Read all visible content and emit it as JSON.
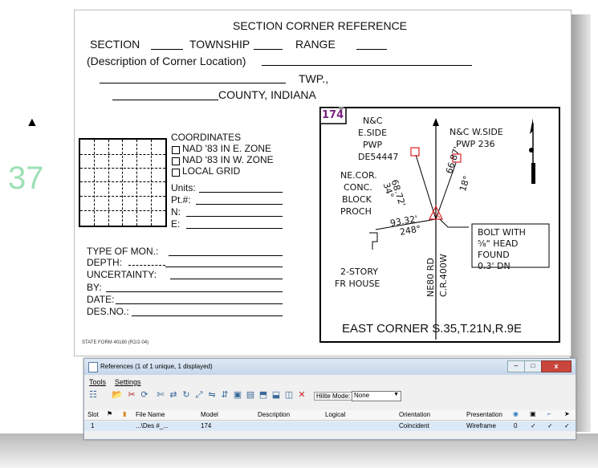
{
  "side": {
    "triangle": "▲",
    "number": "37"
  },
  "form": {
    "title": "SECTION CORNER REFERENCE",
    "section_label": "SECTION",
    "township_label": "TOWNSHIP",
    "range_label": "RANGE",
    "description_label": "(Description of Corner Location)",
    "twp_label": "TWP.,",
    "county_label": "COUNTY, INDIANA",
    "coordinates_label": "COORDINATES",
    "nad_e": "NAD '83 IN E. ZONE",
    "nad_w": "NAD '83 IN W. ZONE",
    "local_grid": "LOCAL GRID",
    "units": "Units:",
    "pt": "Pt.#:",
    "n": "N:",
    "e": "E:",
    "type_mon": "TYPE OF MON.:",
    "depth": "DEPTH:",
    "uncertainty": "UNCERTAINTY:",
    "by": "BY:",
    "date": "DATE:",
    "desno": "DES.NO.:",
    "state_form": "STATE FORM 40180 (R2/2-04)"
  },
  "sketch": {
    "number": "174",
    "nc_e": "N&C",
    "eside": "E.SIDE",
    "pwp_e": "PWP",
    "de": "DE54447",
    "ne_cor": "NE.COR.",
    "conc": "CONC.",
    "block": "BLOCK",
    "proch": "PROCH",
    "nc_w": "N&C W.SIDE",
    "pwp_w": "PWP 236",
    "dist1": "68.72'",
    "ang1": "34°",
    "dist2": "66.87'",
    "ang2": "18°",
    "dist3": "93.32'",
    "ang3": "248°",
    "bolt1": "BOLT WITH",
    "bolt2": "⅝\" HEAD",
    "bolt3": "FOUND",
    "bolt4": "0.3' DN",
    "house1": "2-STORY",
    "house2": "FR HOUSE",
    "road1": "NE80 RD",
    "road2": "C.R.400W",
    "caption": "EAST CORNER S.35,T.21N,R.9E"
  },
  "refs": {
    "title": "References (1 of 1 unique, 1 displayed)",
    "menu": [
      "Tools",
      "Settings"
    ],
    "hilite_label": "Hilite Mode:",
    "hilite_value": "None",
    "columns": [
      "Slot",
      "File Name",
      "Model",
      "Description",
      "Logical",
      "Orientation",
      "Presentation"
    ],
    "row": {
      "slot": "1",
      "file": "...\\Des #_...",
      "model": "174",
      "description": "",
      "logical": "",
      "orientation": "Coincident",
      "presentation": "Wireframe",
      "num": "0",
      "c1": "✓",
      "c2": "✓",
      "c3": "✓"
    },
    "colors": {
      "title_bg": "#c5d6ea",
      "close": "#c9463d",
      "row_bg": "#dbe8f7"
    }
  }
}
